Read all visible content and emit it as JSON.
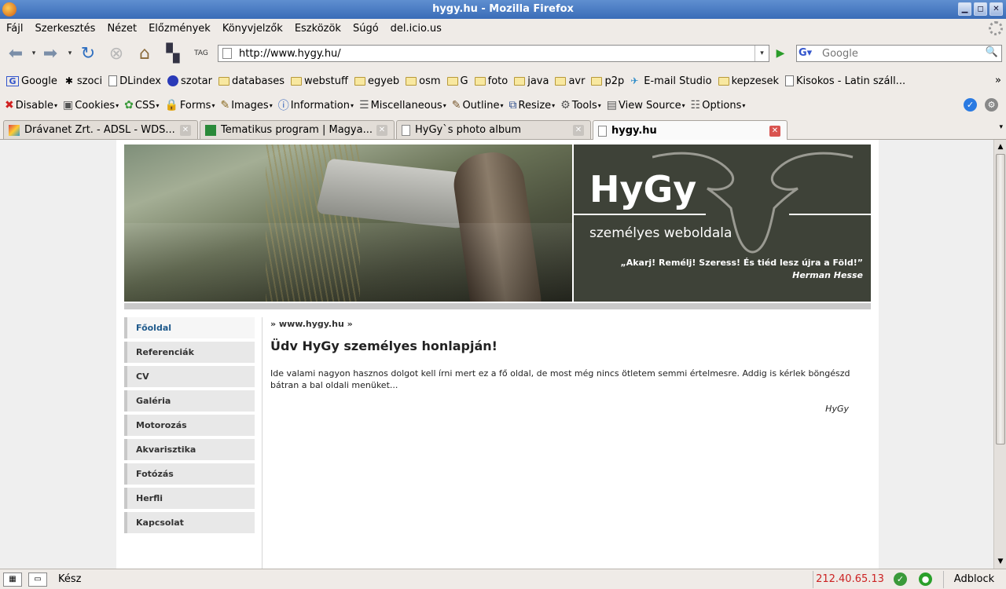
{
  "window": {
    "title": "hygy.hu - Mozilla Firefox"
  },
  "menu": [
    "Fájl",
    "Szerkesztés",
    "Nézet",
    "Előzmények",
    "Könyvjelzők",
    "Eszközök",
    "Súgó",
    "del.icio.us"
  ],
  "nav": {
    "url": "http://www.hygy.hu/",
    "search_placeholder": "Google",
    "tag_label": "TAG"
  },
  "bookmarks": [
    {
      "label": "Google",
      "icon": "google-icon"
    },
    {
      "label": "szoci",
      "icon": "bug-icon"
    },
    {
      "label": "DLindex",
      "icon": "page-icon"
    },
    {
      "label": "szotar",
      "icon": "globe-icon"
    },
    {
      "label": "databases",
      "icon": "folder-icon"
    },
    {
      "label": "webstuff",
      "icon": "folder-icon"
    },
    {
      "label": "egyeb",
      "icon": "folder-icon"
    },
    {
      "label": "osm",
      "icon": "folder-icon"
    },
    {
      "label": "G",
      "icon": "folder-icon"
    },
    {
      "label": "foto",
      "icon": "folder-icon"
    },
    {
      "label": "java",
      "icon": "folder-icon"
    },
    {
      "label": "avr",
      "icon": "folder-icon"
    },
    {
      "label": "p2p",
      "icon": "folder-icon"
    },
    {
      "label": "E-mail Studio",
      "icon": "email-icon"
    },
    {
      "label": "kepzesek",
      "icon": "folder-icon"
    },
    {
      "label": "Kisokos - Latin száll...",
      "icon": "page-icon"
    }
  ],
  "devtools": [
    {
      "label": "Disable",
      "icon": "✖",
      "color": "#d02020"
    },
    {
      "label": "Cookies",
      "icon": "▣",
      "color": "#555555"
    },
    {
      "label": "CSS",
      "icon": "✿",
      "color": "#3a9a3a"
    },
    {
      "label": "Forms",
      "icon": "🔒",
      "color": "#c8a020"
    },
    {
      "label": "Images",
      "icon": "✎",
      "color": "#8a6a20"
    },
    {
      "label": "Information",
      "icon": "ⓘ",
      "color": "#2a5cb8"
    },
    {
      "label": "Miscellaneous",
      "icon": "☰",
      "color": "#555555"
    },
    {
      "label": "Outline",
      "icon": "✎",
      "color": "#7a5a30"
    },
    {
      "label": "Resize",
      "icon": "⧉",
      "color": "#2a4a8a"
    },
    {
      "label": "Tools",
      "icon": "⚙",
      "color": "#555555"
    },
    {
      "label": "View Source",
      "icon": "▤",
      "color": "#555555"
    },
    {
      "label": "Options",
      "icon": "☷",
      "color": "#555555"
    }
  ],
  "tabs": [
    {
      "title": "Drávanet Zrt. - ADSL - WDS...",
      "active": false
    },
    {
      "title": "Tematikus program | Magya...",
      "active": false
    },
    {
      "title": "HyGy`s photo album",
      "active": false
    },
    {
      "title": "hygy.hu",
      "active": true
    }
  ],
  "site": {
    "brand": "HyGy",
    "subtitle": "személyes weboldala",
    "quote": "„Akarj! Remélj! Szeress! És tiéd lesz újra a Föld!”",
    "quote_author": "Herman Hesse",
    "nav": [
      "Főoldal",
      "Referenciák",
      "CV",
      "Galéria",
      "Motorozás",
      "Akvarisztika",
      "Fotózás",
      "Herfli",
      "Kapcsolat"
    ],
    "active_nav": "Főoldal",
    "breadcrumb": "» www.hygy.hu »",
    "heading": "Üdv HyGy személyes honlapján!",
    "paragraph": "Ide valami nagyon hasznos dolgot kell írni mert ez a fő oldal, de most még nincs ötletem semmi értelmesre. Addig is kérlek böngészd bátran a bal oldali menüket...",
    "signature": "HyGy"
  },
  "status": {
    "text": "Kész",
    "ip": "212.40.65.13",
    "adblock": "Adblock"
  },
  "colors": {
    "title_bar": "#3a6cb8",
    "header_green": "#3e4238",
    "active_nav": "#1f5a8c",
    "ip_red": "#cc2222"
  }
}
